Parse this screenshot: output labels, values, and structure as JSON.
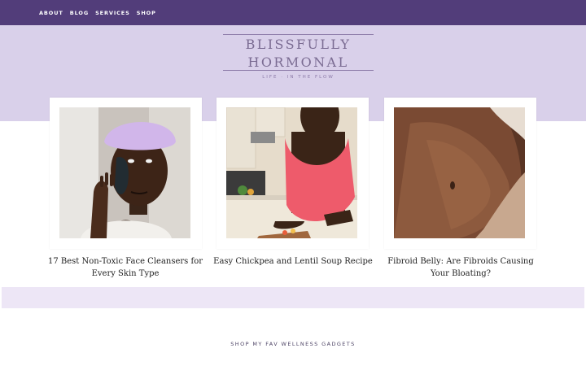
{
  "nav": {
    "links": [
      "ABOUT",
      "BLOG",
      "SERVICES",
      "SHOP"
    ]
  },
  "header": {
    "logo_line1": "BLISSFULLY",
    "logo_line2": "HORMONAL",
    "tagline": "LIFE · IN THE FLOW"
  },
  "posts": [
    {
      "title": "17 Best Non-Toxic Face Cleansers for Every Skin Type"
    },
    {
      "title": "Easy Chickpea and Lentil Soup Recipe"
    },
    {
      "title": "Fibroid Belly: Are Fibroids Causing Your Bloating?"
    }
  ],
  "shop": {
    "heading": "SHOP MY FAV WELLNESS GADGETS"
  },
  "colors": {
    "nav_bg": "#523d7a",
    "header_bg": "#d9d0ea",
    "accent_bar": "#ede6f6"
  }
}
